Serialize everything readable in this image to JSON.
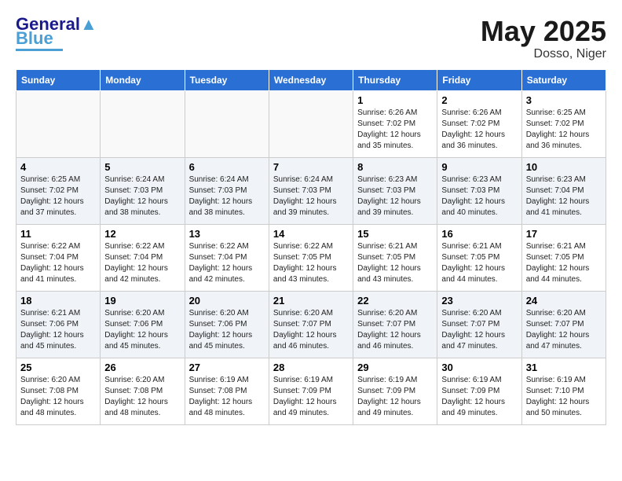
{
  "header": {
    "logo_line1": "General",
    "logo_line2": "Blue",
    "month": "May 2025",
    "location": "Dosso, Niger"
  },
  "days_of_week": [
    "Sunday",
    "Monday",
    "Tuesday",
    "Wednesday",
    "Thursday",
    "Friday",
    "Saturday"
  ],
  "weeks": [
    [
      {
        "day": "",
        "info": ""
      },
      {
        "day": "",
        "info": ""
      },
      {
        "day": "",
        "info": ""
      },
      {
        "day": "",
        "info": ""
      },
      {
        "day": "1",
        "info": "Sunrise: 6:26 AM\nSunset: 7:02 PM\nDaylight: 12 hours\nand 35 minutes."
      },
      {
        "day": "2",
        "info": "Sunrise: 6:26 AM\nSunset: 7:02 PM\nDaylight: 12 hours\nand 36 minutes."
      },
      {
        "day": "3",
        "info": "Sunrise: 6:25 AM\nSunset: 7:02 PM\nDaylight: 12 hours\nand 36 minutes."
      }
    ],
    [
      {
        "day": "4",
        "info": "Sunrise: 6:25 AM\nSunset: 7:02 PM\nDaylight: 12 hours\nand 37 minutes."
      },
      {
        "day": "5",
        "info": "Sunrise: 6:24 AM\nSunset: 7:03 PM\nDaylight: 12 hours\nand 38 minutes."
      },
      {
        "day": "6",
        "info": "Sunrise: 6:24 AM\nSunset: 7:03 PM\nDaylight: 12 hours\nand 38 minutes."
      },
      {
        "day": "7",
        "info": "Sunrise: 6:24 AM\nSunset: 7:03 PM\nDaylight: 12 hours\nand 39 minutes."
      },
      {
        "day": "8",
        "info": "Sunrise: 6:23 AM\nSunset: 7:03 PM\nDaylight: 12 hours\nand 39 minutes."
      },
      {
        "day": "9",
        "info": "Sunrise: 6:23 AM\nSunset: 7:03 PM\nDaylight: 12 hours\nand 40 minutes."
      },
      {
        "day": "10",
        "info": "Sunrise: 6:23 AM\nSunset: 7:04 PM\nDaylight: 12 hours\nand 41 minutes."
      }
    ],
    [
      {
        "day": "11",
        "info": "Sunrise: 6:22 AM\nSunset: 7:04 PM\nDaylight: 12 hours\nand 41 minutes."
      },
      {
        "day": "12",
        "info": "Sunrise: 6:22 AM\nSunset: 7:04 PM\nDaylight: 12 hours\nand 42 minutes."
      },
      {
        "day": "13",
        "info": "Sunrise: 6:22 AM\nSunset: 7:04 PM\nDaylight: 12 hours\nand 42 minutes."
      },
      {
        "day": "14",
        "info": "Sunrise: 6:22 AM\nSunset: 7:05 PM\nDaylight: 12 hours\nand 43 minutes."
      },
      {
        "day": "15",
        "info": "Sunrise: 6:21 AM\nSunset: 7:05 PM\nDaylight: 12 hours\nand 43 minutes."
      },
      {
        "day": "16",
        "info": "Sunrise: 6:21 AM\nSunset: 7:05 PM\nDaylight: 12 hours\nand 44 minutes."
      },
      {
        "day": "17",
        "info": "Sunrise: 6:21 AM\nSunset: 7:05 PM\nDaylight: 12 hours\nand 44 minutes."
      }
    ],
    [
      {
        "day": "18",
        "info": "Sunrise: 6:21 AM\nSunset: 7:06 PM\nDaylight: 12 hours\nand 45 minutes."
      },
      {
        "day": "19",
        "info": "Sunrise: 6:20 AM\nSunset: 7:06 PM\nDaylight: 12 hours\nand 45 minutes."
      },
      {
        "day": "20",
        "info": "Sunrise: 6:20 AM\nSunset: 7:06 PM\nDaylight: 12 hours\nand 45 minutes."
      },
      {
        "day": "21",
        "info": "Sunrise: 6:20 AM\nSunset: 7:07 PM\nDaylight: 12 hours\nand 46 minutes."
      },
      {
        "day": "22",
        "info": "Sunrise: 6:20 AM\nSunset: 7:07 PM\nDaylight: 12 hours\nand 46 minutes."
      },
      {
        "day": "23",
        "info": "Sunrise: 6:20 AM\nSunset: 7:07 PM\nDaylight: 12 hours\nand 47 minutes."
      },
      {
        "day": "24",
        "info": "Sunrise: 6:20 AM\nSunset: 7:07 PM\nDaylight: 12 hours\nand 47 minutes."
      }
    ],
    [
      {
        "day": "25",
        "info": "Sunrise: 6:20 AM\nSunset: 7:08 PM\nDaylight: 12 hours\nand 48 minutes."
      },
      {
        "day": "26",
        "info": "Sunrise: 6:20 AM\nSunset: 7:08 PM\nDaylight: 12 hours\nand 48 minutes."
      },
      {
        "day": "27",
        "info": "Sunrise: 6:19 AM\nSunset: 7:08 PM\nDaylight: 12 hours\nand 48 minutes."
      },
      {
        "day": "28",
        "info": "Sunrise: 6:19 AM\nSunset: 7:09 PM\nDaylight: 12 hours\nand 49 minutes."
      },
      {
        "day": "29",
        "info": "Sunrise: 6:19 AM\nSunset: 7:09 PM\nDaylight: 12 hours\nand 49 minutes."
      },
      {
        "day": "30",
        "info": "Sunrise: 6:19 AM\nSunset: 7:09 PM\nDaylight: 12 hours\nand 49 minutes."
      },
      {
        "day": "31",
        "info": "Sunrise: 6:19 AM\nSunset: 7:10 PM\nDaylight: 12 hours\nand 50 minutes."
      }
    ]
  ]
}
